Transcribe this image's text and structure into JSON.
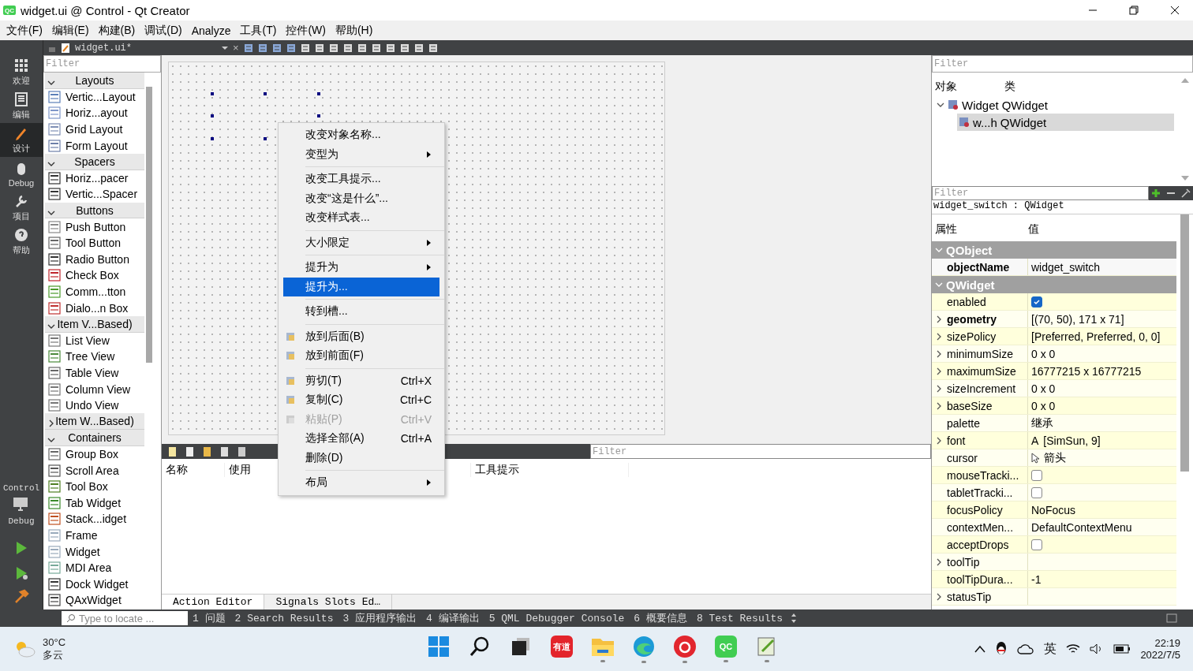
{
  "window": {
    "title": "widget.ui @ Control - Qt Creator",
    "logo": "QC"
  },
  "menu_bar": [
    "文件(F)",
    "编辑(E)",
    "构建(B)",
    "调试(D)",
    "Analyze",
    "工具(T)",
    "控件(W)",
    "帮助(H)"
  ],
  "mode_bar": [
    {
      "label": "欢迎",
      "selected": false
    },
    {
      "label": "编辑",
      "selected": false
    },
    {
      "label": "设计",
      "selected": true
    },
    {
      "label": "Debug",
      "selected": false
    },
    {
      "label": "项目",
      "selected": false
    },
    {
      "label": "帮助",
      "selected": false
    }
  ],
  "kit": {
    "project": "Control",
    "build": "Debug"
  },
  "editor_toolbar": {
    "file": "widget.ui*",
    "close": "×"
  },
  "widget_box": {
    "filter_placeholder": "Filter",
    "categories": [
      {
        "title": "Layouts",
        "expanded": true,
        "items": [
          "Vertic...Layout",
          "Horiz...ayout",
          "Grid Layout",
          "Form Layout"
        ]
      },
      {
        "title": "Spacers",
        "expanded": true,
        "items": [
          "Horiz...pacer",
          "Vertic...Spacer"
        ]
      },
      {
        "title": "Buttons",
        "expanded": true,
        "items": [
          "Push Button",
          "Tool Button",
          "Radio Button",
          "Check Box",
          "Comm...tton",
          "Dialo...n Box"
        ]
      },
      {
        "title": "Item V...Based)",
        "expanded": true,
        "items": [
          "List View",
          "Tree View",
          "Table View",
          "Column View",
          "Undo View"
        ]
      },
      {
        "title": "Item W...Based)",
        "expanded": false
      },
      {
        "title": "Containers",
        "expanded": true,
        "items": [
          "Group Box",
          "Scroll Area",
          "Tool Box",
          "Tab Widget",
          "Stack...idget",
          "Frame",
          "Widget",
          "MDI Area",
          "Dock Widget",
          "QAxWidget"
        ]
      }
    ]
  },
  "context_menu": [
    {
      "kind": "item",
      "label": "改变对象名称...",
      "submenu": false,
      "selected": false,
      "disabled": false
    },
    {
      "kind": "item",
      "label": "变型为",
      "submenu": true,
      "selected": false,
      "disabled": false
    },
    {
      "kind": "separator"
    },
    {
      "kind": "item",
      "label": "改变工具提示...",
      "submenu": false,
      "selected": false,
      "disabled": false
    },
    {
      "kind": "item",
      "label": "改变“这是什么”...",
      "submenu": false,
      "selected": false,
      "disabled": false
    },
    {
      "kind": "item",
      "label": "改变样式表...",
      "submenu": false,
      "selected": false,
      "disabled": false
    },
    {
      "kind": "separator"
    },
    {
      "kind": "item",
      "label": "大小限定",
      "submenu": true,
      "selected": false,
      "disabled": false
    },
    {
      "kind": "separator"
    },
    {
      "kind": "item",
      "label": "提升为",
      "submenu": true,
      "selected": false,
      "disabled": false
    },
    {
      "kind": "item",
      "label": "提升为...",
      "submenu": false,
      "selected": true,
      "disabled": false
    },
    {
      "kind": "separator"
    },
    {
      "kind": "item",
      "label": "转到槽...",
      "submenu": false,
      "selected": false,
      "disabled": false
    },
    {
      "kind": "separator"
    },
    {
      "kind": "icon-item",
      "label": "放到后面(B)",
      "submenu": false,
      "selected": false,
      "disabled": false
    },
    {
      "kind": "icon-item",
      "label": "放到前面(F)",
      "submenu": false,
      "selected": false,
      "disabled": false
    },
    {
      "kind": "separator"
    },
    {
      "kind": "icon-item",
      "label": "剪切(T)",
      "shortcut": "Ctrl+X",
      "submenu": false,
      "selected": false,
      "disabled": false
    },
    {
      "kind": "icon-item",
      "label": "复制(C)",
      "shortcut": "Ctrl+C",
      "submenu": false,
      "selected": false,
      "disabled": false
    },
    {
      "kind": "icon-item",
      "label": "粘贴(P)",
      "shortcut": "Ctrl+V",
      "submenu": false,
      "selected": false,
      "disabled": true
    },
    {
      "kind": "item",
      "label": "选择全部(A)",
      "shortcut": "Ctrl+A",
      "submenu": false,
      "selected": false,
      "disabled": false
    },
    {
      "kind": "item",
      "label": "删除(D)",
      "submenu": false,
      "selected": false,
      "disabled": false
    },
    {
      "kind": "separator"
    },
    {
      "kind": "item",
      "label": "布局",
      "submenu": true,
      "selected": false,
      "disabled": false
    }
  ],
  "action_editor": {
    "filter_placeholder": "Filter",
    "columns": [
      "名称",
      "使用",
      "工具提示"
    ],
    "tabs": [
      {
        "label": "Action Editor",
        "selected": true
      },
      {
        "label": "Signals  Slots Ed…",
        "selected": false
      }
    ]
  },
  "object_inspector": {
    "filter_placeholder": "Filter",
    "columns": [
      "对象",
      "类"
    ],
    "tree": [
      {
        "object": "Widget",
        "class": "QWidget",
        "expanded": true,
        "selected": false,
        "children": [
          {
            "object": "w...h",
            "class": "QWidget",
            "selected": true
          }
        ]
      }
    ]
  },
  "property_editor": {
    "filter_placeholder": "Filter",
    "subject": "widget_switch : QWidget",
    "columns": [
      "属性",
      "值"
    ],
    "rows": [
      {
        "kind": "group",
        "name": "QObject",
        "expanded": true
      },
      {
        "kind": "text",
        "name": "objectName",
        "value": "widget_switch",
        "bold": true,
        "expandable": false
      },
      {
        "kind": "group",
        "name": "QWidget",
        "expanded": true
      },
      {
        "kind": "checkbox",
        "name": "enabled",
        "checked": true,
        "bold": false,
        "expandable": false
      },
      {
        "kind": "text",
        "name": "geometry",
        "value": "[(70, 50), 171 x 71]",
        "bold": true,
        "expandable": true
      },
      {
        "kind": "text",
        "name": "sizePolicy",
        "value": "[Preferred, Preferred, 0, 0]",
        "bold": false,
        "expandable": true
      },
      {
        "kind": "text",
        "name": "minimumSize",
        "value": "0 x 0",
        "bold": false,
        "expandable": true
      },
      {
        "kind": "text",
        "name": "maximumSize",
        "value": "16777215 x 16777215",
        "bold": false,
        "expandable": true
      },
      {
        "kind": "text",
        "name": "sizeIncrement",
        "value": "0 x 0",
        "bold": false,
        "expandable": true
      },
      {
        "kind": "text",
        "name": "baseSize",
        "value": "0 x 0",
        "bold": false,
        "expandable": true
      },
      {
        "kind": "text",
        "name": "palette",
        "value": "继承",
        "bold": false,
        "expandable": false
      },
      {
        "kind": "font",
        "name": "font",
        "glyph": "A",
        "value": "[SimSun, 9]",
        "bold": false,
        "expandable": true
      },
      {
        "kind": "cursor",
        "name": "cursor",
        "value": "箭头",
        "bold": false,
        "expandable": false
      },
      {
        "kind": "checkbox",
        "name": "mouseTracki...",
        "checked": false,
        "bold": false,
        "expandable": false
      },
      {
        "kind": "checkbox",
        "name": "tabletTracki...",
        "checked": false,
        "bold": false,
        "expandable": false
      },
      {
        "kind": "text",
        "name": "focusPolicy",
        "value": "NoFocus",
        "bold": false,
        "expandable": false
      },
      {
        "kind": "text",
        "name": "contextMen...",
        "value": "DefaultContextMenu",
        "bold": false,
        "expandable": false
      },
      {
        "kind": "checkbox",
        "name": "acceptDrops",
        "checked": false,
        "bold": false,
        "expandable": false
      },
      {
        "kind": "text",
        "name": "toolTip",
        "bold": false,
        "expandable": true
      },
      {
        "kind": "text",
        "name": "toolTipDura...",
        "value": "-1",
        "bold": false,
        "expandable": false
      },
      {
        "kind": "text",
        "name": "statusTip",
        "bold": false,
        "expandable": true
      }
    ]
  },
  "status_bar": {
    "locate_placeholder": "Type to locate ...",
    "panes": [
      "1 问题",
      "2 Search Results",
      "3 应用程序输出",
      "4 编译输出",
      "5 QML Debugger Console",
      "6 概要信息",
      "8 Test Results"
    ]
  },
  "taskbar": {
    "weather": {
      "temperature": "30°C",
      "condition": "多云"
    },
    "apps": [
      {
        "kind": "start",
        "active": false
      },
      {
        "kind": "search",
        "active": false
      },
      {
        "kind": "taskview",
        "active": false
      },
      {
        "kind": "dict",
        "label": "有道",
        "active": false
      },
      {
        "kind": "folder",
        "active": true
      },
      {
        "kind": "browser",
        "active": true
      },
      {
        "kind": "music",
        "active": true
      },
      {
        "kind": "qt",
        "label": "QC",
        "active": true
      },
      {
        "kind": "notepad",
        "active": true
      }
    ],
    "input_method": "英",
    "time": "22:19",
    "date": "2022/7/5"
  }
}
